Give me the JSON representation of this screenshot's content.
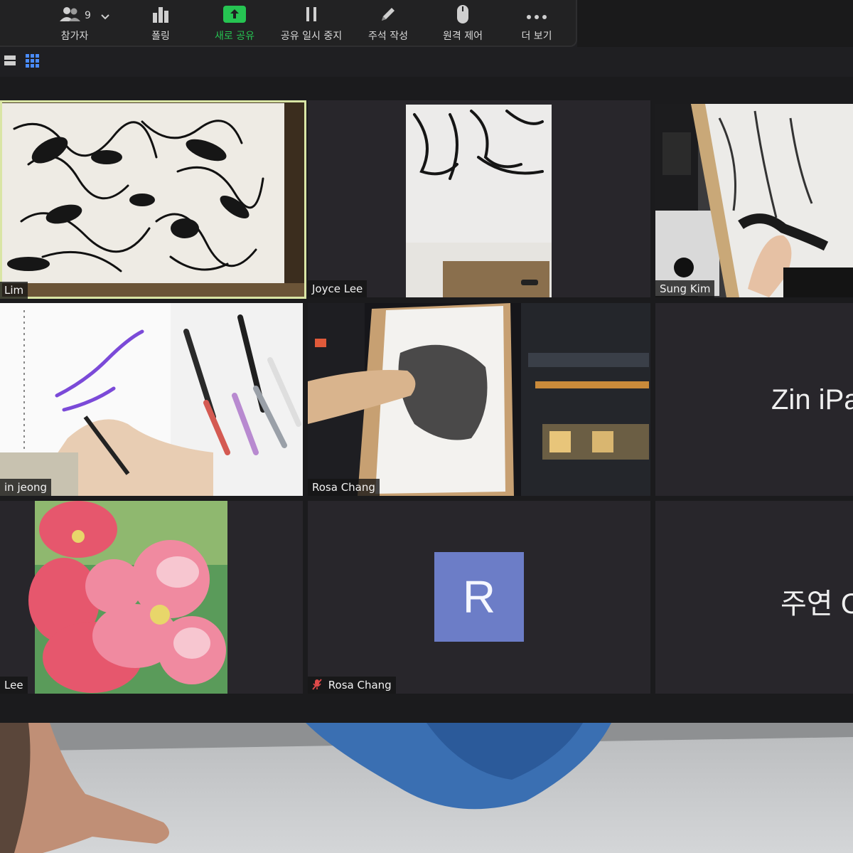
{
  "toolbar": {
    "participants": {
      "label": "참가자",
      "count": "9",
      "icon": "participants-icon"
    },
    "polling": {
      "label": "폴링",
      "icon": "bar-chart-icon"
    },
    "new_share": {
      "label": "새로 공유",
      "icon": "share-up-arrow-icon"
    },
    "pause_share": {
      "label": "공유 일시 중지",
      "icon": "pause-icon"
    },
    "annotate": {
      "label": "주석 작성",
      "icon": "pencil-icon"
    },
    "remote_control": {
      "label": "원격 제어",
      "icon": "mouse-icon"
    },
    "more": {
      "label": "더 보기",
      "icon": "ellipsis-icon"
    }
  },
  "colors": {
    "share_accent": "#26c452",
    "active_border": "#d9e5a5",
    "avatar_bg": "#6c7dc7",
    "tile_bg": "#28262b"
  },
  "tiles": [
    {
      "name": "Lim",
      "content": "ink figure sketches on paper"
    },
    {
      "name": "Joyce Lee",
      "content": "charcoal figure sketch on easel"
    },
    {
      "name": "Sung Kim",
      "content": "drawing on easel with hand"
    },
    {
      "name": "in jeong",
      "content": "drawing with markers on sketchbook"
    },
    {
      "name": "Rosa Chang",
      "content": "hand drawing at easel by window"
    },
    {
      "name": "",
      "big_text": "Zin iPa"
    },
    {
      "name": "Lee",
      "content": "pink flower painting"
    },
    {
      "name": "Rosa Chang",
      "avatar_letter": "R",
      "muted": true
    },
    {
      "name": "",
      "big_text": "주연 C"
    }
  ]
}
